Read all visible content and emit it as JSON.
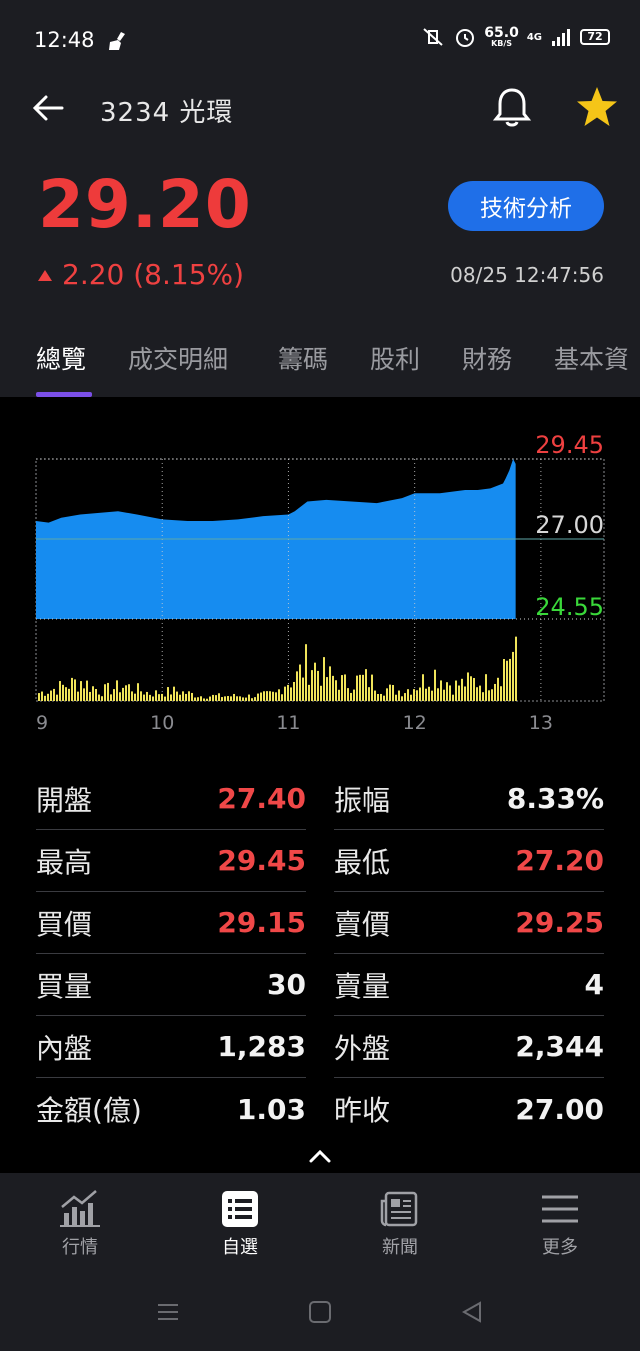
{
  "status_bar": {
    "time": "12:48",
    "speed_value": "65.0",
    "speed_unit": "KB/S",
    "network": "4G",
    "battery": "72"
  },
  "header": {
    "title": "3234 光環"
  },
  "quote": {
    "price": "29.20",
    "change": "2.20 (8.15%)",
    "timestamp": "08/25 12:47:56",
    "tech_button": "技術分析",
    "up_color": "#ee3b3b"
  },
  "tabs": [
    {
      "label": "總覽",
      "active": true
    },
    {
      "label": "成交明細"
    },
    {
      "label": "籌碼"
    },
    {
      "label": "股利"
    },
    {
      "label": "財務"
    },
    {
      "label": "基本資"
    }
  ],
  "chart_data": {
    "type": "area",
    "y_labels": {
      "high": "29.45",
      "ref": "27.00",
      "low": "24.55"
    },
    "ylim": [
      24.55,
      29.45
    ],
    "reference": 27.0,
    "x_ticks": [
      "9",
      "10",
      "11",
      "12",
      "13"
    ],
    "xlim": [
      9,
      13.5
    ],
    "price_series": {
      "x": [
        9.0,
        9.1,
        9.2,
        9.35,
        9.5,
        9.65,
        9.8,
        10.0,
        10.2,
        10.4,
        10.6,
        10.8,
        11.0,
        11.05,
        11.15,
        11.3,
        11.5,
        11.7,
        11.9,
        12.0,
        12.2,
        12.4,
        12.5,
        12.6,
        12.7,
        12.72,
        12.75,
        12.78,
        12.8
      ],
      "y": [
        27.55,
        27.5,
        27.65,
        27.75,
        27.8,
        27.85,
        27.75,
        27.6,
        27.55,
        27.55,
        27.6,
        27.7,
        27.75,
        27.85,
        28.15,
        28.2,
        28.15,
        28.1,
        28.25,
        28.4,
        28.4,
        28.5,
        28.5,
        28.55,
        28.7,
        28.85,
        29.1,
        29.45,
        29.3
      ]
    },
    "volume_series": {
      "x": [
        9.0,
        9.15,
        9.35,
        9.5,
        9.7,
        9.9,
        10.1,
        10.3,
        10.5,
        10.7,
        10.9,
        10.95,
        11.05,
        11.15,
        11.3,
        11.45,
        11.6,
        11.75,
        11.9,
        12.0,
        12.15,
        12.3,
        12.45,
        12.55,
        12.65,
        12.7,
        12.75,
        12.8
      ],
      "y": [
        0.15,
        0.25,
        0.4,
        0.2,
        0.3,
        0.15,
        0.2,
        0.1,
        0.1,
        0.1,
        0.15,
        0.35,
        0.45,
        0.8,
        0.5,
        0.35,
        0.45,
        0.25,
        0.2,
        0.3,
        0.55,
        0.3,
        0.4,
        0.35,
        0.6,
        0.75,
        1.0,
        0.85
      ]
    }
  },
  "stats": [
    {
      "label": "開盤",
      "value": "27.40",
      "color": "red"
    },
    {
      "label": "振幅",
      "value": "8.33%",
      "color": "white"
    },
    {
      "label": "最高",
      "value": "29.45",
      "color": "red"
    },
    {
      "label": "最低",
      "value": "27.20",
      "color": "red"
    },
    {
      "label": "買價",
      "value": "29.15",
      "color": "red"
    },
    {
      "label": "賣價",
      "value": "29.25",
      "color": "red"
    },
    {
      "label": "買量",
      "value": "30",
      "color": "white"
    },
    {
      "label": "賣量",
      "value": "4",
      "color": "white"
    },
    {
      "label": "內盤",
      "value": "1,283",
      "color": "white"
    },
    {
      "label": "外盤",
      "value": "2,344",
      "color": "white"
    },
    {
      "label": "金額(億)",
      "value": "1.03",
      "color": "white"
    },
    {
      "label": "昨收",
      "value": "27.00",
      "color": "white"
    }
  ],
  "bottom_nav": [
    {
      "label": "行情",
      "icon": "chart-icon"
    },
    {
      "label": "自選",
      "icon": "list-icon",
      "active": true
    },
    {
      "label": "新聞",
      "icon": "news-icon"
    },
    {
      "label": "更多",
      "icon": "menu-icon"
    }
  ]
}
